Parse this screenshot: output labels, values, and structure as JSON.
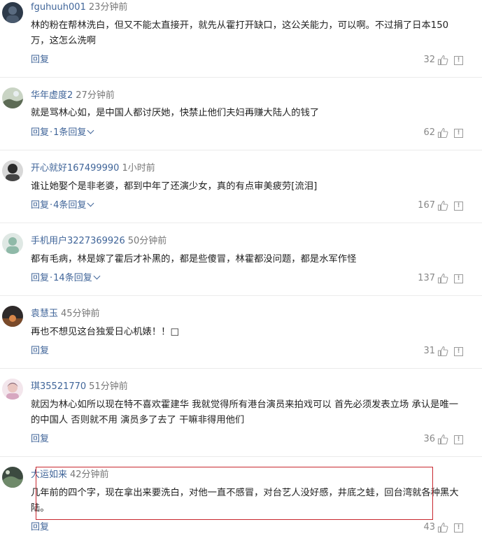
{
  "ui": {
    "reply_label": "回复",
    "report_glyph": "!"
  },
  "comments": [
    {
      "username": "fguhuuh001",
      "time": "23分钟前",
      "text": "林的粉在帮林洗白，但又不能太直接开，就先从霍打开缺口，这公关能力，可以啊。不过捐了日本150万，这怎么洗啊",
      "likes": "32",
      "replies": ""
    },
    {
      "username": "华年虚度2",
      "time": "27分钟前",
      "text": "就是骂林心如，是中国人都讨厌她，快禁止他们夫妇再赚大陆人的钱了",
      "likes": "62",
      "replies": "1条回复"
    },
    {
      "username": "开心就好167499990",
      "time": "1小时前",
      "text": "谁让她娶个是非老婆，都到中年了还演少女，真的有点审美疲劳[流泪]",
      "likes": "167",
      "replies": "4条回复"
    },
    {
      "username": "手机用户3227369926",
      "time": "50分钟前",
      "text": "都有毛病，林是嫁了霍后才补黑的，都是些傻冒，林霍都没问题，都是水军作怪",
      "likes": "137",
      "replies": "14条回复"
    },
    {
      "username": "袁慧玉",
      "time": "45分钟前",
      "text": "再也不想见这台独爱日心机婊！！□",
      "likes": "31",
      "replies": ""
    },
    {
      "username": "琪35521770",
      "time": "51分钟前",
      "text": "就因为林心如所以现在特不喜欢霍建华 我就觉得所有港台演员来拍戏可以 首先必须发表立场 承认是唯一的中国人 否则就不用 演员多了去了 干嘛非得用他们",
      "likes": "36",
      "replies": ""
    },
    {
      "username": "大运如来",
      "time": "42分钟前",
      "text": "几年前的四个字，现在拿出来要洗白，对他一直不感冒，对台艺人没好感，井底之蛙，回台湾就各种黑大陆。",
      "likes": "43",
      "replies": ""
    }
  ]
}
